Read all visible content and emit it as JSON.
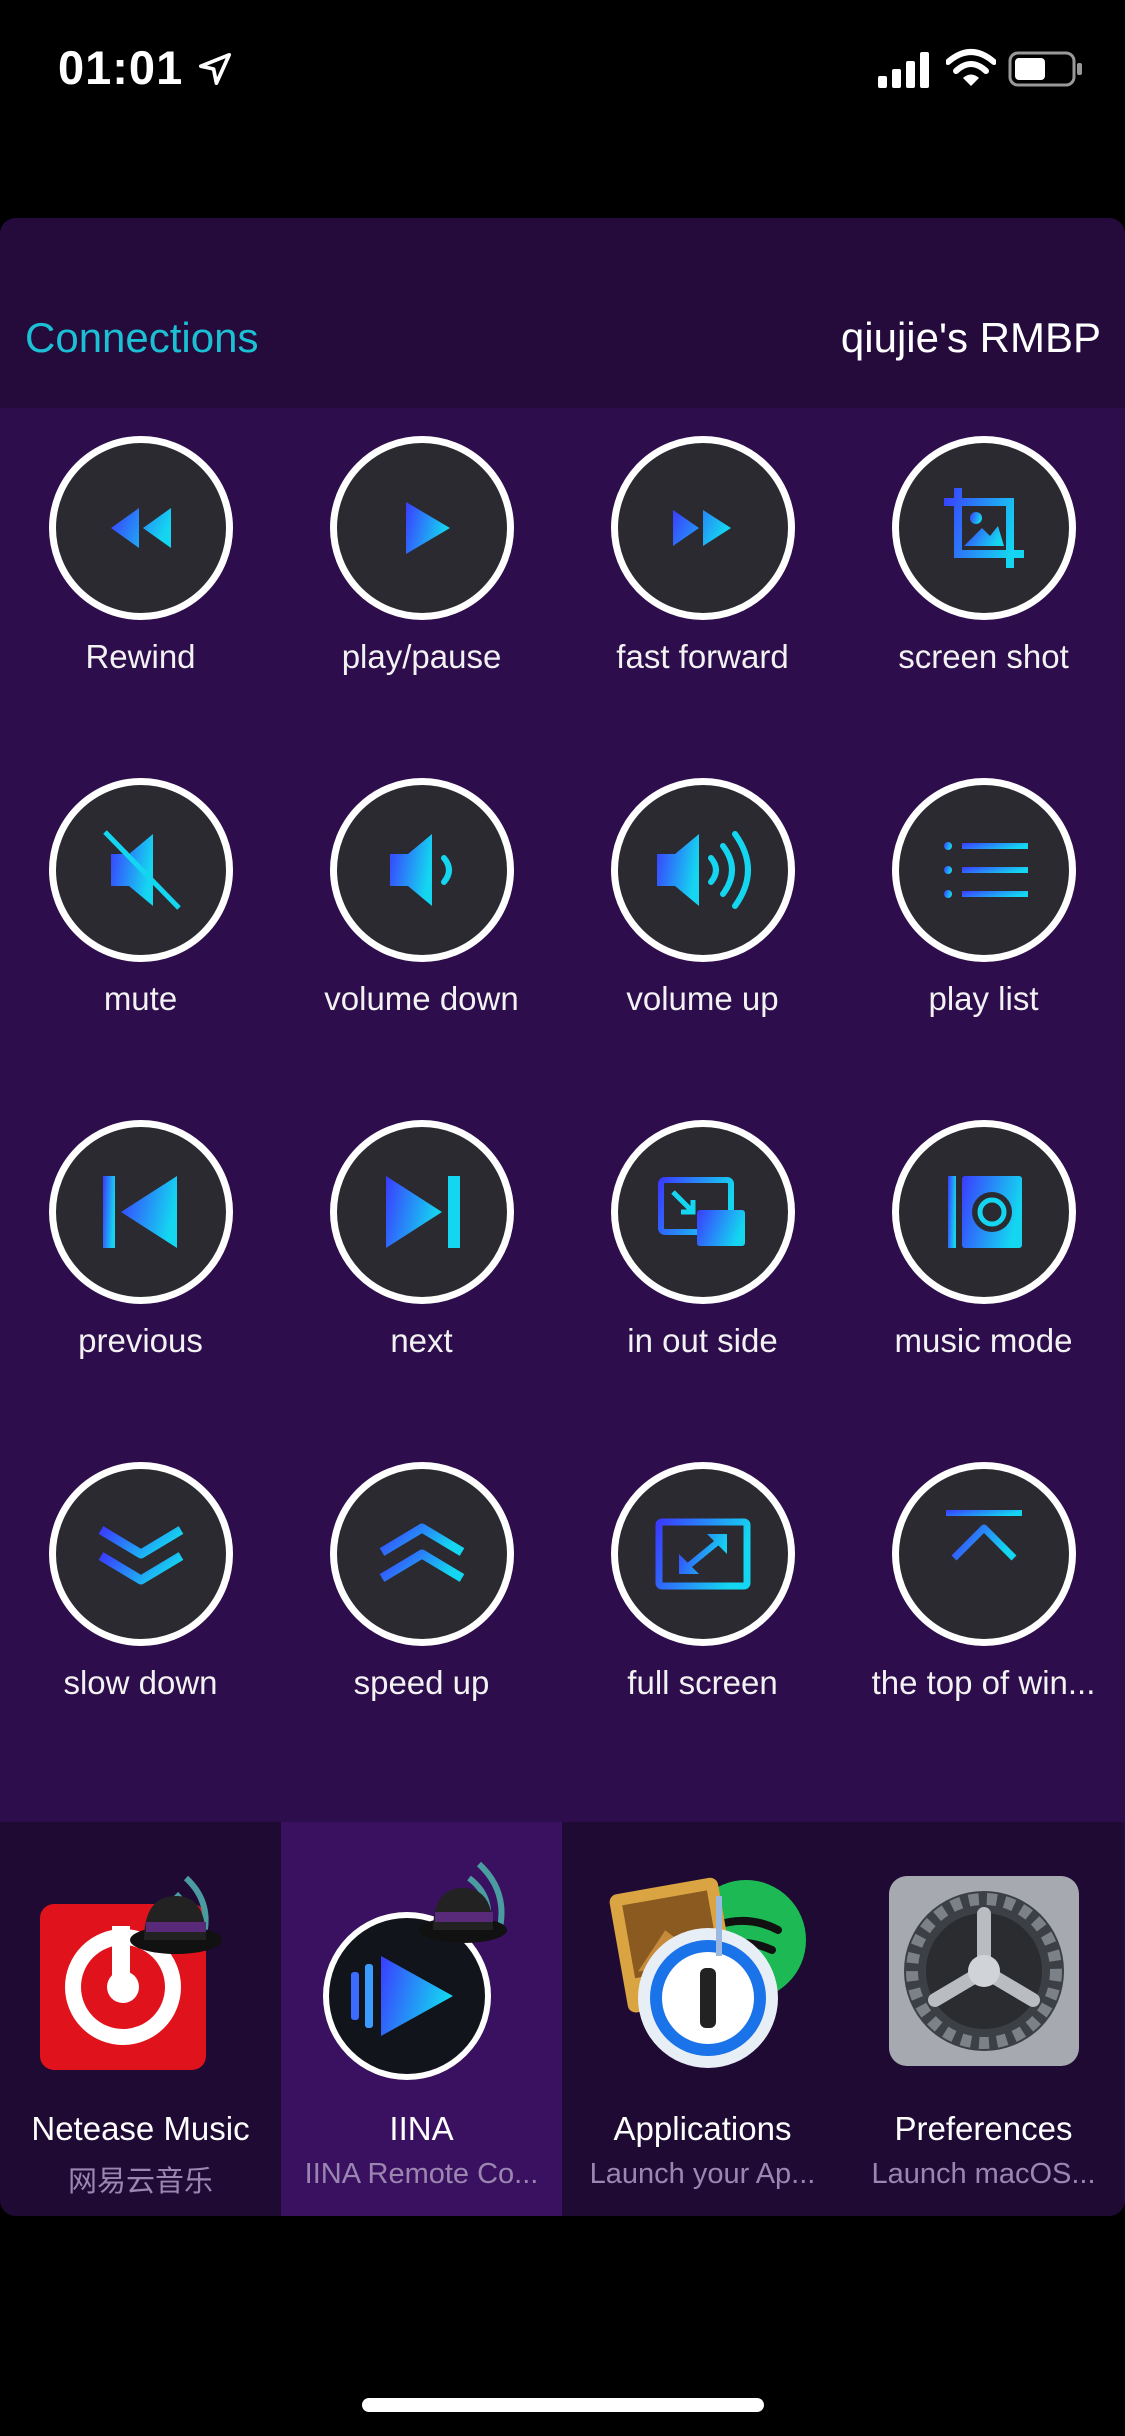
{
  "status_bar": {
    "time": "01:01",
    "icons": [
      "location-arrow-icon",
      "cellular-signal-icon",
      "wifi-icon",
      "battery-icon"
    ]
  },
  "header": {
    "connections_label": "Connections",
    "device_name": "qiujie's RMBP"
  },
  "controls": [
    {
      "label": "Rewind",
      "icon": "rewind-icon"
    },
    {
      "label": "play/pause",
      "icon": "play-icon"
    },
    {
      "label": "fast forward",
      "icon": "fast-forward-icon"
    },
    {
      "label": "screen shot",
      "icon": "screenshot-icon"
    },
    {
      "label": "mute",
      "icon": "mute-icon"
    },
    {
      "label": "volume down",
      "icon": "volume-down-icon"
    },
    {
      "label": "volume up",
      "icon": "volume-up-icon"
    },
    {
      "label": "play list",
      "icon": "playlist-icon"
    },
    {
      "label": "previous",
      "icon": "previous-icon"
    },
    {
      "label": "next",
      "icon": "next-icon"
    },
    {
      "label": "in out side",
      "icon": "picture-in-picture-icon"
    },
    {
      "label": "music mode",
      "icon": "music-mode-icon"
    },
    {
      "label": "slow down",
      "icon": "chevrons-down-icon"
    },
    {
      "label": "speed up",
      "icon": "chevrons-up-icon"
    },
    {
      "label": "full screen",
      "icon": "fullscreen-icon"
    },
    {
      "label": "the top of win...",
      "icon": "arrow-to-top-icon"
    }
  ],
  "apps": [
    {
      "title": "Netease Music",
      "subtitle": "网易云音乐",
      "icon": "netease-music-icon"
    },
    {
      "title": "IINA",
      "subtitle": "IINA Remote Co...",
      "icon": "iina-icon"
    },
    {
      "title": "Applications",
      "subtitle": "Launch your Ap...",
      "icon": "applications-icon"
    },
    {
      "title": "Preferences",
      "subtitle": "Launch macOS...",
      "icon": "preferences-gear-icon"
    }
  ],
  "colors": {
    "accent": "#1cc0d4",
    "panel": "#2e0d4c",
    "header": "#250a3c",
    "icon_gradient_start": "#3a3cff",
    "icon_gradient_end": "#14d6f0"
  }
}
